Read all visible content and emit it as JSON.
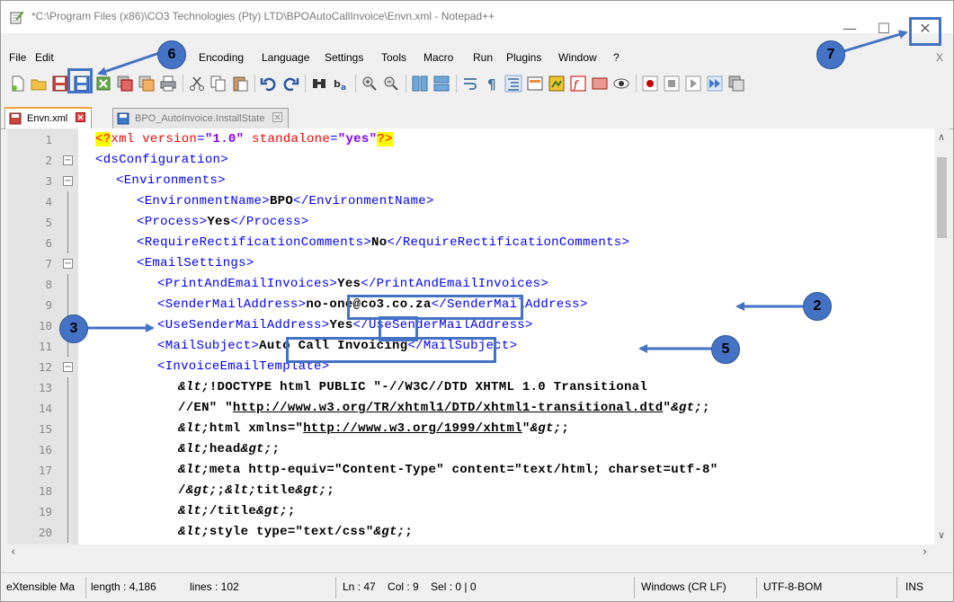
{
  "window": {
    "title": "*C:\\Program Files (x86)\\CO3 Technologies (Pty) LTD\\BPOAutoCallInvoice\\Envn.xml - Notepad++",
    "minimize": "—",
    "maximize": "☐",
    "close": "✕"
  },
  "menu": {
    "items": [
      "File",
      "Edit",
      "Encoding",
      "Language",
      "Settings",
      "Tools",
      "Macro",
      "Run",
      "Plugins",
      "Window",
      "?"
    ],
    "close_doc": "X"
  },
  "tabs": [
    {
      "label": "Envn.xml",
      "active": true
    },
    {
      "label": "BPO_AutoInvoice.InstallState",
      "active": false
    }
  ],
  "editor": {
    "lines": [
      {
        "n": "1",
        "indent": 0,
        "fold": "",
        "segs": [
          {
            "c": "pi",
            "t": "<?"
          },
          {
            "c": "kw",
            "t": "xml version"
          },
          {
            "c": "t",
            "t": "="
          },
          {
            "c": "str",
            "t": "\"1.0\""
          },
          {
            "c": "kw",
            "t": " standalone"
          },
          {
            "c": "t",
            "t": "="
          },
          {
            "c": "str",
            "t": "\"yes\""
          },
          {
            "c": "pi",
            "t": "?>"
          }
        ]
      },
      {
        "n": "2",
        "indent": 0,
        "fold": "open",
        "segs": [
          {
            "c": "t",
            "t": "<dsConfiguration>"
          }
        ]
      },
      {
        "n": "3",
        "indent": 1,
        "fold": "open",
        "segs": [
          {
            "c": "t",
            "t": "<Environments>"
          }
        ]
      },
      {
        "n": "4",
        "indent": 2,
        "fold": "",
        "segs": [
          {
            "c": "t",
            "t": "<EnvironmentName>"
          },
          {
            "c": "v",
            "t": "BPO"
          },
          {
            "c": "t",
            "t": "</EnvironmentName>"
          }
        ]
      },
      {
        "n": "5",
        "indent": 2,
        "fold": "",
        "segs": [
          {
            "c": "t",
            "t": "<Process>"
          },
          {
            "c": "v",
            "t": "Yes"
          },
          {
            "c": "t",
            "t": "</Process>"
          }
        ]
      },
      {
        "n": "6",
        "indent": 2,
        "fold": "",
        "segs": [
          {
            "c": "t",
            "t": "<RequireRectificationComments>"
          },
          {
            "c": "v",
            "t": "No"
          },
          {
            "c": "t",
            "t": "</RequireRectificationComments>"
          }
        ]
      },
      {
        "n": "7",
        "indent": 2,
        "fold": "open",
        "segs": [
          {
            "c": "t",
            "t": "<EmailSettings>"
          }
        ]
      },
      {
        "n": "8",
        "indent": 3,
        "fold": "",
        "segs": [
          {
            "c": "t",
            "t": "<PrintAndEmailInvoices>"
          },
          {
            "c": "v",
            "t": "Yes"
          },
          {
            "c": "t",
            "t": "</PrintAndEmailInvoices>"
          }
        ]
      },
      {
        "n": "9",
        "indent": 3,
        "fold": "",
        "segs": [
          {
            "c": "t",
            "t": "<SenderMailAddress>"
          },
          {
            "c": "v",
            "t": "no-one@co3.co.za"
          },
          {
            "c": "t",
            "t": "</SenderMailAddress>"
          }
        ]
      },
      {
        "n": "10",
        "indent": 3,
        "fold": "",
        "segs": [
          {
            "c": "t",
            "t": "<UseSenderMailAddress>"
          },
          {
            "c": "v",
            "t": "Yes"
          },
          {
            "c": "t",
            "t": "</UseSenderMailAddress>"
          }
        ]
      },
      {
        "n": "11",
        "indent": 3,
        "fold": "",
        "segs": [
          {
            "c": "t",
            "t": "<MailSubject>"
          },
          {
            "c": "v",
            "t": "Auto Call Invoicing"
          },
          {
            "c": "t",
            "t": "</MailSubject>"
          }
        ]
      },
      {
        "n": "12",
        "indent": 3,
        "fold": "open",
        "segs": [
          {
            "c": "t",
            "t": "<InvoiceEmailTemplate>"
          }
        ]
      },
      {
        "n": "13",
        "indent": 4,
        "fold": "",
        "segs": [
          {
            "c": "ent",
            "t": "&lt;"
          },
          {
            "c": "plain",
            "t": "!DOCTYPE html PUBLIC \"-//W3C//DTD XHTML 1.0 Transitional"
          }
        ]
      },
      {
        "n": "14",
        "indent": 4,
        "fold": "",
        "segs": [
          {
            "c": "plain",
            "t": "//EN\" \""
          },
          {
            "c": "url",
            "t": "http://www.w3.org/TR/xhtml1/DTD/xhtml1-transitional.dtd"
          },
          {
            "c": "plain",
            "t": "\""
          },
          {
            "c": "ent",
            "t": "&gt;"
          },
          {
            "c": "plain",
            "t": ";"
          }
        ]
      },
      {
        "n": "15",
        "indent": 4,
        "fold": "",
        "segs": [
          {
            "c": "ent",
            "t": "&lt;"
          },
          {
            "c": "plain",
            "t": "html xmlns=\""
          },
          {
            "c": "url",
            "t": "http://www.w3.org/1999/xhtml"
          },
          {
            "c": "plain",
            "t": "\""
          },
          {
            "c": "ent",
            "t": "&gt;"
          },
          {
            "c": "plain",
            "t": ";"
          }
        ]
      },
      {
        "n": "16",
        "indent": 4,
        "fold": "",
        "segs": [
          {
            "c": "ent",
            "t": "&lt;"
          },
          {
            "c": "plain",
            "t": "head"
          },
          {
            "c": "ent",
            "t": "&gt;"
          },
          {
            "c": "plain",
            "t": ";"
          }
        ]
      },
      {
        "n": "17",
        "indent": 4,
        "fold": "",
        "segs": [
          {
            "c": "ent",
            "t": "&lt;"
          },
          {
            "c": "plain",
            "t": "meta http-equiv=\"Content-Type\" content=\"text/html; charset=utf-8\""
          }
        ]
      },
      {
        "n": "18",
        "indent": 4,
        "fold": "",
        "segs": [
          {
            "c": "plain",
            "t": "/"
          },
          {
            "c": "ent",
            "t": "&gt;"
          },
          {
            "c": "plain",
            "t": ";"
          },
          {
            "c": "ent",
            "t": "&lt;"
          },
          {
            "c": "plain",
            "t": "title"
          },
          {
            "c": "ent",
            "t": "&gt;"
          },
          {
            "c": "plain",
            "t": ";"
          }
        ]
      },
      {
        "n": "19",
        "indent": 4,
        "fold": "",
        "segs": [
          {
            "c": "ent",
            "t": "&lt;"
          },
          {
            "c": "plain",
            "t": "/title"
          },
          {
            "c": "ent",
            "t": "&gt;"
          },
          {
            "c": "plain",
            "t": ";"
          }
        ]
      },
      {
        "n": "20",
        "indent": 4,
        "fold": "",
        "segs": [
          {
            "c": "ent",
            "t": "&lt;"
          },
          {
            "c": "plain",
            "t": "style type=\"text/css\""
          },
          {
            "c": "ent",
            "t": "&gt;"
          },
          {
            "c": "plain",
            "t": ";"
          }
        ]
      }
    ]
  },
  "statusbar": {
    "language": "eXtensible Ma",
    "length": "length : 4,186",
    "lines": "lines : 102",
    "position": "Ln : 47    Col : 9    Sel : 0 | 0",
    "eol": "Windows (CR LF)",
    "encoding": "UTF-8-BOM",
    "mode": "INS"
  },
  "annotations": {
    "badges": [
      "2",
      "3",
      "5",
      "6",
      "7"
    ],
    "accent": "#4472c4"
  }
}
